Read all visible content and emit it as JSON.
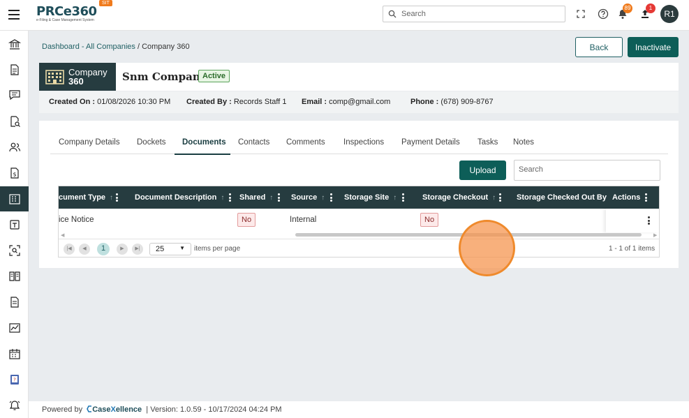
{
  "header": {
    "logo_text": "PRCe360",
    "logo_subtitle": "e-Filing & Case Management System",
    "env_tag": "SIT",
    "search_placeholder": "Search",
    "notifications_count": "89",
    "uploads_count": "1",
    "avatar_initials": "R1"
  },
  "sidebar": {
    "items": [
      {
        "icon": "bank-icon"
      },
      {
        "icon": "document-icon"
      },
      {
        "icon": "chat-icon"
      },
      {
        "icon": "document-search-icon"
      },
      {
        "icon": "users-icon"
      },
      {
        "icon": "dollar-document-icon"
      },
      {
        "icon": "building-icon",
        "active": true
      },
      {
        "icon": "note-icon"
      },
      {
        "icon": "scan-icon"
      },
      {
        "icon": "book-icon"
      },
      {
        "icon": "file-icon"
      },
      {
        "icon": "chart-icon"
      },
      {
        "icon": "calendar-icon"
      },
      {
        "icon": "help-book-icon"
      },
      {
        "icon": "alarm-icon"
      }
    ]
  },
  "breadcrumb": {
    "link": "Dashboard - All Companies",
    "separator": " / ",
    "current": "Company 360"
  },
  "actions": {
    "back": "Back",
    "inactivate": "Inactivate"
  },
  "company": {
    "tag_line1": "Company",
    "tag_line2": "360",
    "name": "Snm Company",
    "status": "Active",
    "created_on_label": "Created On :",
    "created_on": "01/08/2026 10:30 PM",
    "created_by_label": "Created By :",
    "created_by": "Records Staff 1",
    "email_label": "Email :",
    "email": "comp@gmail.com",
    "phone_label": "Phone :",
    "phone": "(678) 909-8767"
  },
  "tabs": [
    {
      "label": "Company Details"
    },
    {
      "label": "Dockets"
    },
    {
      "label": "Documents",
      "active": true
    },
    {
      "label": "Contacts"
    },
    {
      "label": "Comments"
    },
    {
      "label": "Inspections"
    },
    {
      "label": "Payment Details"
    },
    {
      "label": "Tasks"
    },
    {
      "label": "Notes"
    }
  ],
  "documents": {
    "upload_label": "Upload",
    "search_placeholder": "Search",
    "columns": [
      "cument Type",
      "Document Description",
      "Shared",
      "Source",
      "Storage Site",
      "Storage Checkout",
      "Storage Checked Out By",
      "Actions"
    ],
    "rows": [
      {
        "document_type": "ice Notice",
        "document_description": "",
        "shared": "No",
        "source": "Internal",
        "storage_site": "",
        "storage_checkout": "No",
        "storage_checked_out_by": ""
      }
    ],
    "pager": {
      "current_page": "1",
      "page_size": "25",
      "items_per_page_label": "items per page",
      "summary": "1 - 1 of 1 items"
    }
  },
  "footer": {
    "powered_by": "Powered by",
    "brand_a": "Case",
    "brand_b": "X",
    "brand_c": "ellence",
    "version": "|  Version: 1.0.59 - 10/17/2024 04:24 PM"
  },
  "colors": {
    "primary": "#0d5e58",
    "dark": "#263c40",
    "accent": "#f07b1d",
    "danger": "#e53935"
  }
}
